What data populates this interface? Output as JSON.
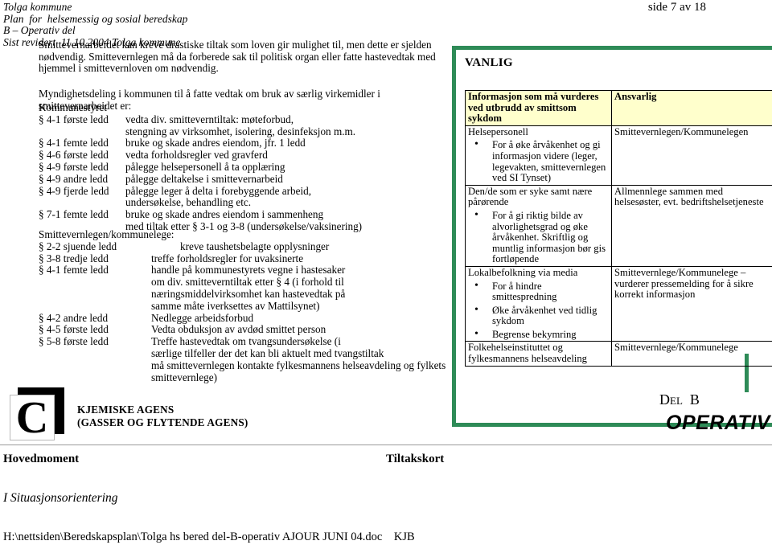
{
  "header": {
    "lines": [
      "Tolga kommune",
      "Plan  for  helsemessig og sosial beredskap",
      "B – Operativ del",
      "Sist revidert  11.10.2004 Tolga kommune"
    ],
    "page_number": "side 7 av 18"
  },
  "intro": {
    "paragraph": "Smittevernarbeidet kan kreve drastiske tiltak som loven gir mulighet til, men dette er sjelden nødvendig. Smittevernlegen må da forberede sak til politisk organ eller fatte hastevedtak med hjemmel i smittevernloven om nødvendig."
  },
  "section": {
    "heading": "Myndighetsdeling i kommunen til å fatte vedtak om bruk av særlig virkemidler i smittevernarbeidet er:"
  },
  "delegations": [
    {
      "id": "kommunestyret",
      "title": "Kommunestyret",
      "ref_width": "narrow",
      "rows": [
        {
          "ref": "§ 4-1 første ledd",
          "desc": "vedta div. smitteverntiltak: møteforbud,",
          "cont": [
            "stengning av virksomhet, isolering, desinfeksjon m.m."
          ]
        },
        {
          "ref": "§ 4-1 femte ledd",
          "desc": "bruke og skade andres eiendom, jfr. 1 ledd",
          "cont": []
        },
        {
          "ref": "§ 4-6 første ledd",
          "desc": "vedta forholdsregler ved gravferd",
          "cont": []
        },
        {
          "ref": "§ 4-9 første ledd",
          "desc": "pålegge helsepersonell å ta opplæring",
          "cont": []
        },
        {
          "ref": "§ 4-9 andre ledd",
          "desc": "pålegge deltakelse i smittevernarbeid",
          "cont": []
        },
        {
          "ref": "§ 4-9 fjerde ledd",
          "desc": "pålegge leger å delta i forebyggende arbeid,",
          "cont": [
            "undersøkelse, behandling etc."
          ]
        },
        {
          "ref": "§ 7-1 femte ledd",
          "desc": "bruke og skade andres eiendom i sammenheng",
          "cont": [
            "med tiltak etter § 3-1 og 3-8 (undersøkelse/vaksinering)"
          ]
        }
      ]
    },
    {
      "id": "smittevernlegen",
      "title": "Smittevernlegen/kommunelege:",
      "ref_width": "wide",
      "rows": [
        {
          "ref": "§ 2-2 sjuende ledd",
          "desc": "kreve taushetsbelagte opplysninger",
          "indent": true,
          "cont": []
        },
        {
          "ref": "§ 3-8 tredje ledd",
          "desc": "treffe forholdsregler for uvaksinerte",
          "cont": []
        },
        {
          "ref": "§ 4-1 femte ledd",
          "desc": "handle på kommunestyrets vegne i hastesaker",
          "cont": [
            "om div. smitteverntiltak etter § 4 (i forhold til",
            "næringsmiddelvirksomhet kan hastevedtak på",
            "samme måte iverksettes av Mattilsynet)"
          ]
        },
        {
          "ref": "§ 4-2 andre ledd",
          "desc": "Nedlegge arbeidsforbud",
          "cont": []
        },
        {
          "ref": "§ 4-5 første ledd",
          "desc": "Vedta obduksjon av avdød smittet person",
          "cont": []
        },
        {
          "ref": "§ 5-8 første ledd",
          "desc": "Treffe hastevedtak om tvangsundersøkelse (i",
          "cont": [
            "særlige tilfeller der det kan bli aktuelt med tvangstiltak",
            "må smittevernlegen kontakte fylkesmannens helseavdeling og fylkets",
            "smittevernlege)"
          ]
        }
      ]
    }
  ],
  "panel": {
    "label": "VANLIG",
    "border_color": "#2e8b57",
    "header_bg": "#ffffcc",
    "table": {
      "columns": [
        "Informasjon som må vurderes ved utbrudd av smittsom sykdom",
        "Ansvarlig"
      ],
      "rows": [
        {
          "lead": "Helsepersonell",
          "bullets": [
            "For å øke årvåkenhet og gi informasjon videre (leger, legevakten, smittevernlegen ved SI Tynset)"
          ],
          "responsible": "Smittevernlegen/Kommunelegen"
        },
        {
          "lead": "Den/de som er syke samt nære pårørende",
          "bullets": [
            "For å gi riktig bilde av alvorlighetsgrad og øke årvåkenhet. Skriftlig og muntlig informasjon bør gis fortløpende"
          ],
          "responsible": "Allmennlege sammen med helsesøster, evt. bedriftshelsetjeneste"
        },
        {
          "lead": "Lokalbefolkning via media",
          "bullets": [
            "For å hindre smittespredning",
            "Øke årvåkenhet ved tidlig sykdom",
            "Begrense bekymring"
          ],
          "responsible": "Smittevernlege/Kommunelege – vurderer pressemelding for å sikre korrekt informasjon"
        },
        {
          "lead": "Folkehelseinstituttet og fylkesmannens helseavdeling",
          "bullets": [],
          "responsible": "Smittevernlege/Kommunelege"
        }
      ]
    }
  },
  "bottom": {
    "logo_letter": "C",
    "agens_title_line1": "KJEMISKE AGENS",
    "agens_title_line2": "(GASSER OG FLYTENDE AGENS)",
    "del_b_big": "D",
    "del_b_small": "EL",
    "del_b_letter": "B",
    "operativ_del": "OPERATIV DEL"
  },
  "footer": {
    "heading_left": "Hovedmoment",
    "heading_right": "Tiltakskort",
    "situasjon": "I Situasjonsorientering",
    "file_path": "H:\\nettsiden\\Beredskapsplan\\Tolga hs bered del-B-operativ AJOUR JUNI 04.doc    KJB"
  }
}
